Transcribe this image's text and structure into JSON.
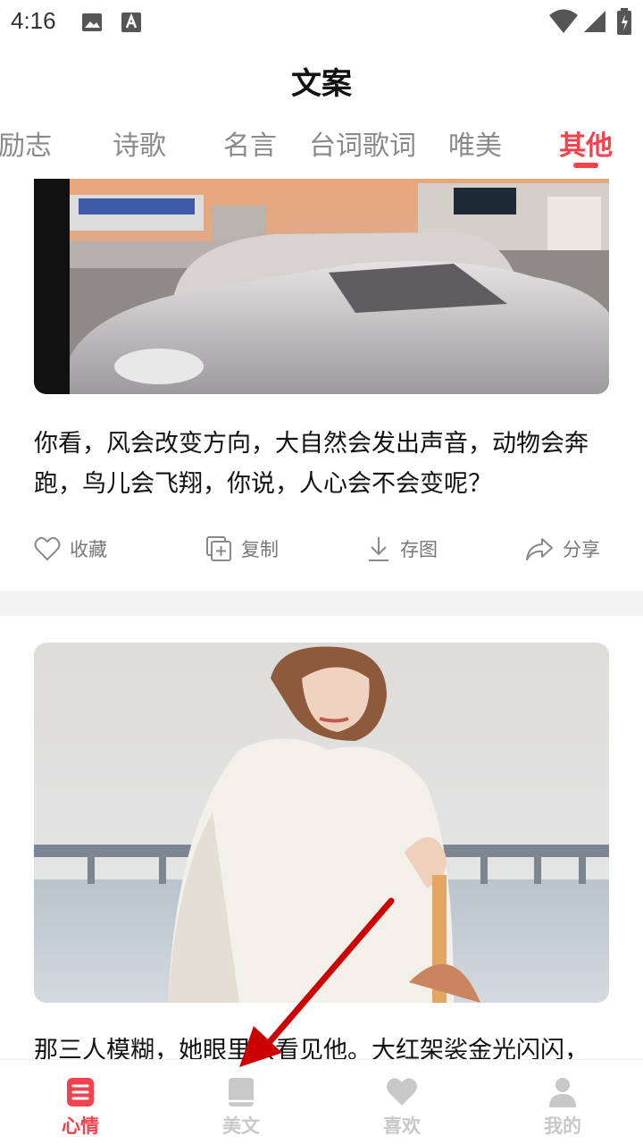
{
  "status_bar": {
    "time": "4:16"
  },
  "header": {
    "title": "文案"
  },
  "tabs": [
    {
      "label": "励志",
      "active": false
    },
    {
      "label": "诗歌",
      "active": false
    },
    {
      "label": "名言",
      "active": false
    },
    {
      "label": "台词歌词",
      "active": false
    },
    {
      "label": "唯美",
      "active": false
    },
    {
      "label": "其他",
      "active": true
    }
  ],
  "feed": {
    "cards": [
      {
        "text": "你看，风会改变方向，大自然会发出声音，动物会奔跑，鸟儿会飞翔，你说，人心会不会变呢？",
        "actions": {
          "favorite": "收藏",
          "copy": "复制",
          "save_image": "存图",
          "share": "分享"
        }
      },
      {
        "text": "那三人模糊，她眼里只看见他。大红架裟金光闪闪，"
      }
    ]
  },
  "bottom_nav": [
    {
      "label": "心情",
      "icon": "list-icon",
      "active": true
    },
    {
      "label": "美文",
      "icon": "book-icon",
      "active": false
    },
    {
      "label": "喜欢",
      "icon": "heart-icon",
      "active": false
    },
    {
      "label": "我的",
      "icon": "person-icon",
      "active": false
    }
  ],
  "colors": {
    "accent": "#f0434f",
    "inactive": "#c8c8c8",
    "annotation_arrow": "#cc0000"
  }
}
